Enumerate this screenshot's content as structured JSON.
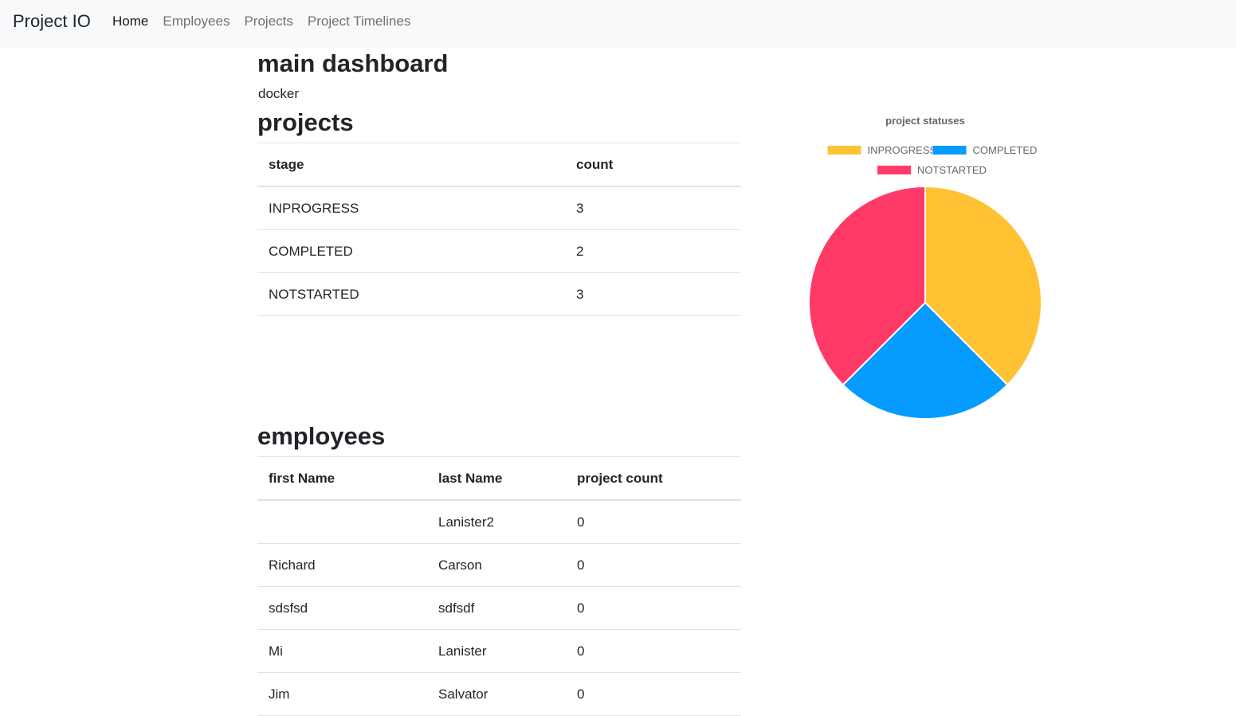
{
  "nav": {
    "brand": "Project IO",
    "links": [
      {
        "label": "Home",
        "active": true
      },
      {
        "label": "Employees",
        "active": false
      },
      {
        "label": "Projects",
        "active": false
      },
      {
        "label": "Project Timelines",
        "active": false
      }
    ]
  },
  "main": {
    "title": "main dashboard",
    "subtitle": "docker"
  },
  "projects": {
    "title": "projects",
    "headers": [
      "stage",
      "count"
    ],
    "rows": [
      [
        "INPROGRESS",
        "3"
      ],
      [
        "COMPLETED",
        "2"
      ],
      [
        "NOTSTARTED",
        "3"
      ]
    ]
  },
  "employees": {
    "title": "employees",
    "headers": [
      "first Name",
      "last Name",
      "project count"
    ],
    "rows": [
      [
        "",
        "Lanister2",
        "0"
      ],
      [
        "Richard",
        "Carson",
        "0"
      ],
      [
        "sdsfsd",
        "sdfsdf",
        "0"
      ],
      [
        "Mi",
        "Lanister",
        "0"
      ],
      [
        "Jim",
        "Salvator",
        "0"
      ]
    ]
  },
  "chart_data": {
    "type": "pie",
    "title": "project statuses",
    "categories": [
      "INPROGRESS",
      "COMPLETED",
      "NOTSTARTED"
    ],
    "values": [
      3,
      2,
      3
    ],
    "colors": [
      "#ffc233",
      "#059bff",
      "#ff3a67"
    ],
    "legend": "top"
  }
}
